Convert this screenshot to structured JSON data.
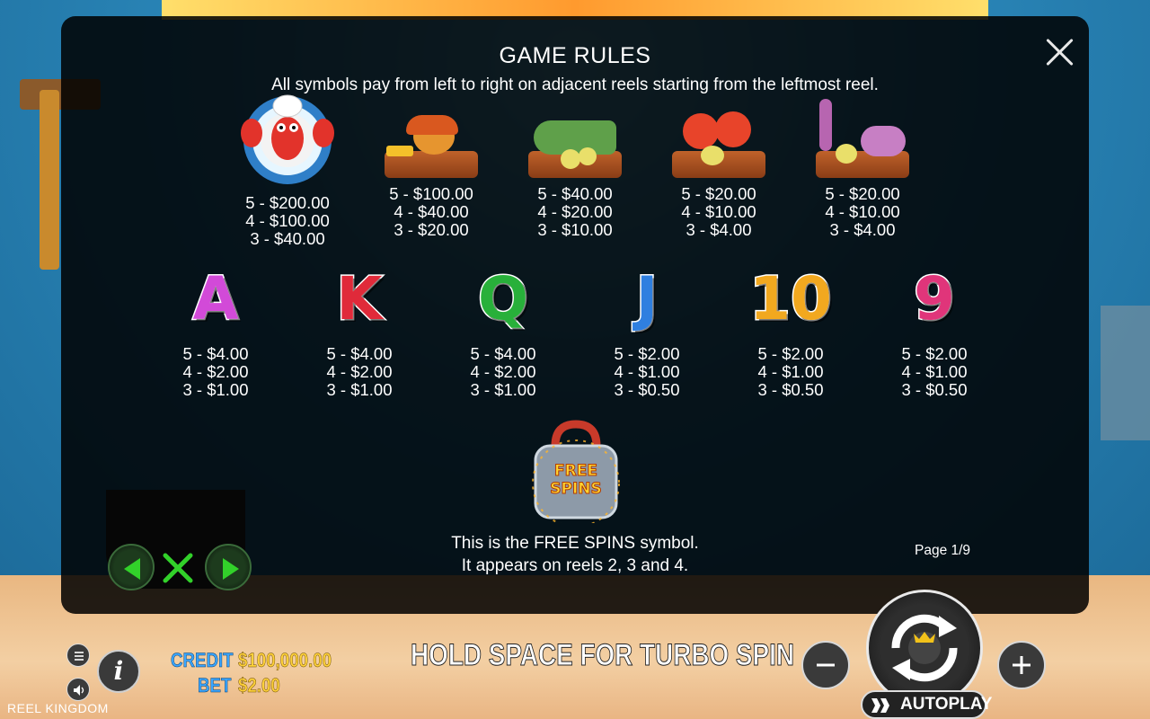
{
  "title": "GAME RULES",
  "subtitle": "All symbols pay from left to right on adjacent reels starting from the leftmost reel.",
  "high_symbols": [
    {
      "icon": "lobster-chef-icon",
      "pays": [
        "5 - $200.00",
        "4 - $100.00",
        "3 - $40.00"
      ]
    },
    {
      "icon": "crab-burger-icon",
      "pays": [
        "5 - $100.00",
        "4 - $40.00",
        "3 - $20.00"
      ]
    },
    {
      "icon": "fish-plate-icon",
      "pays": [
        "5 - $40.00",
        "4 - $20.00",
        "3 - $10.00"
      ]
    },
    {
      "icon": "shrimp-plate-icon",
      "pays": [
        "5 - $20.00",
        "4 - $10.00",
        "3 - $4.00"
      ]
    },
    {
      "icon": "octopus-plate-icon",
      "pays": [
        "5 - $20.00",
        "4 - $10.00",
        "3 - $4.00"
      ]
    }
  ],
  "low_symbols": [
    {
      "glyph": "A",
      "color": "#d24ad8",
      "icon": "letter-a-icon",
      "pays": [
        "5 - $4.00",
        "4 - $2.00",
        "3 - $1.00"
      ]
    },
    {
      "glyph": "K",
      "color": "#e02a3a",
      "icon": "letter-k-icon",
      "pays": [
        "5 - $4.00",
        "4 - $2.00",
        "3 - $1.00"
      ]
    },
    {
      "glyph": "Q",
      "color": "#28b03a",
      "icon": "letter-q-icon",
      "pays": [
        "5 - $4.00",
        "4 - $2.00",
        "3 - $1.00"
      ]
    },
    {
      "glyph": "J",
      "color": "#2f7fe0",
      "icon": "letter-j-icon",
      "pays": [
        "5 - $2.00",
        "4 - $1.00",
        "3 - $0.50"
      ]
    },
    {
      "glyph": "10",
      "color": "#f2a81f",
      "icon": "number-10-icon",
      "pays": [
        "5 - $2.00",
        "4 - $1.00",
        "3 - $0.50"
      ]
    },
    {
      "glyph": "9",
      "color": "#e0357a",
      "icon": "number-9-icon",
      "pays": [
        "5 - $2.00",
        "4 - $1.00",
        "3 - $0.50"
      ]
    }
  ],
  "free_spins": {
    "logo_line1": "FREE",
    "logo_line2": "SPINS",
    "desc_line1": "This is the FREE SPINS symbol.",
    "desc_line2": "It appears on reels 2, 3 and 4."
  },
  "page": "Page 1/9",
  "hud": {
    "brand": "REEL KINGDOM",
    "credit_label": "CREDIT",
    "credit_value": "$100,000.00",
    "bet_label": "BET",
    "bet_value": "$2.00",
    "hold_text": "HOLD SPACE FOR TURBO SPIN",
    "autoplay_label": "AUTOPLAY",
    "info_label": "i"
  },
  "colors": {
    "panel": "rgba(0,0,0,0.86)",
    "nav_green": "#32d12a",
    "credit_blue": "#3aa6ff",
    "credit_gold": "#ffd23a"
  }
}
